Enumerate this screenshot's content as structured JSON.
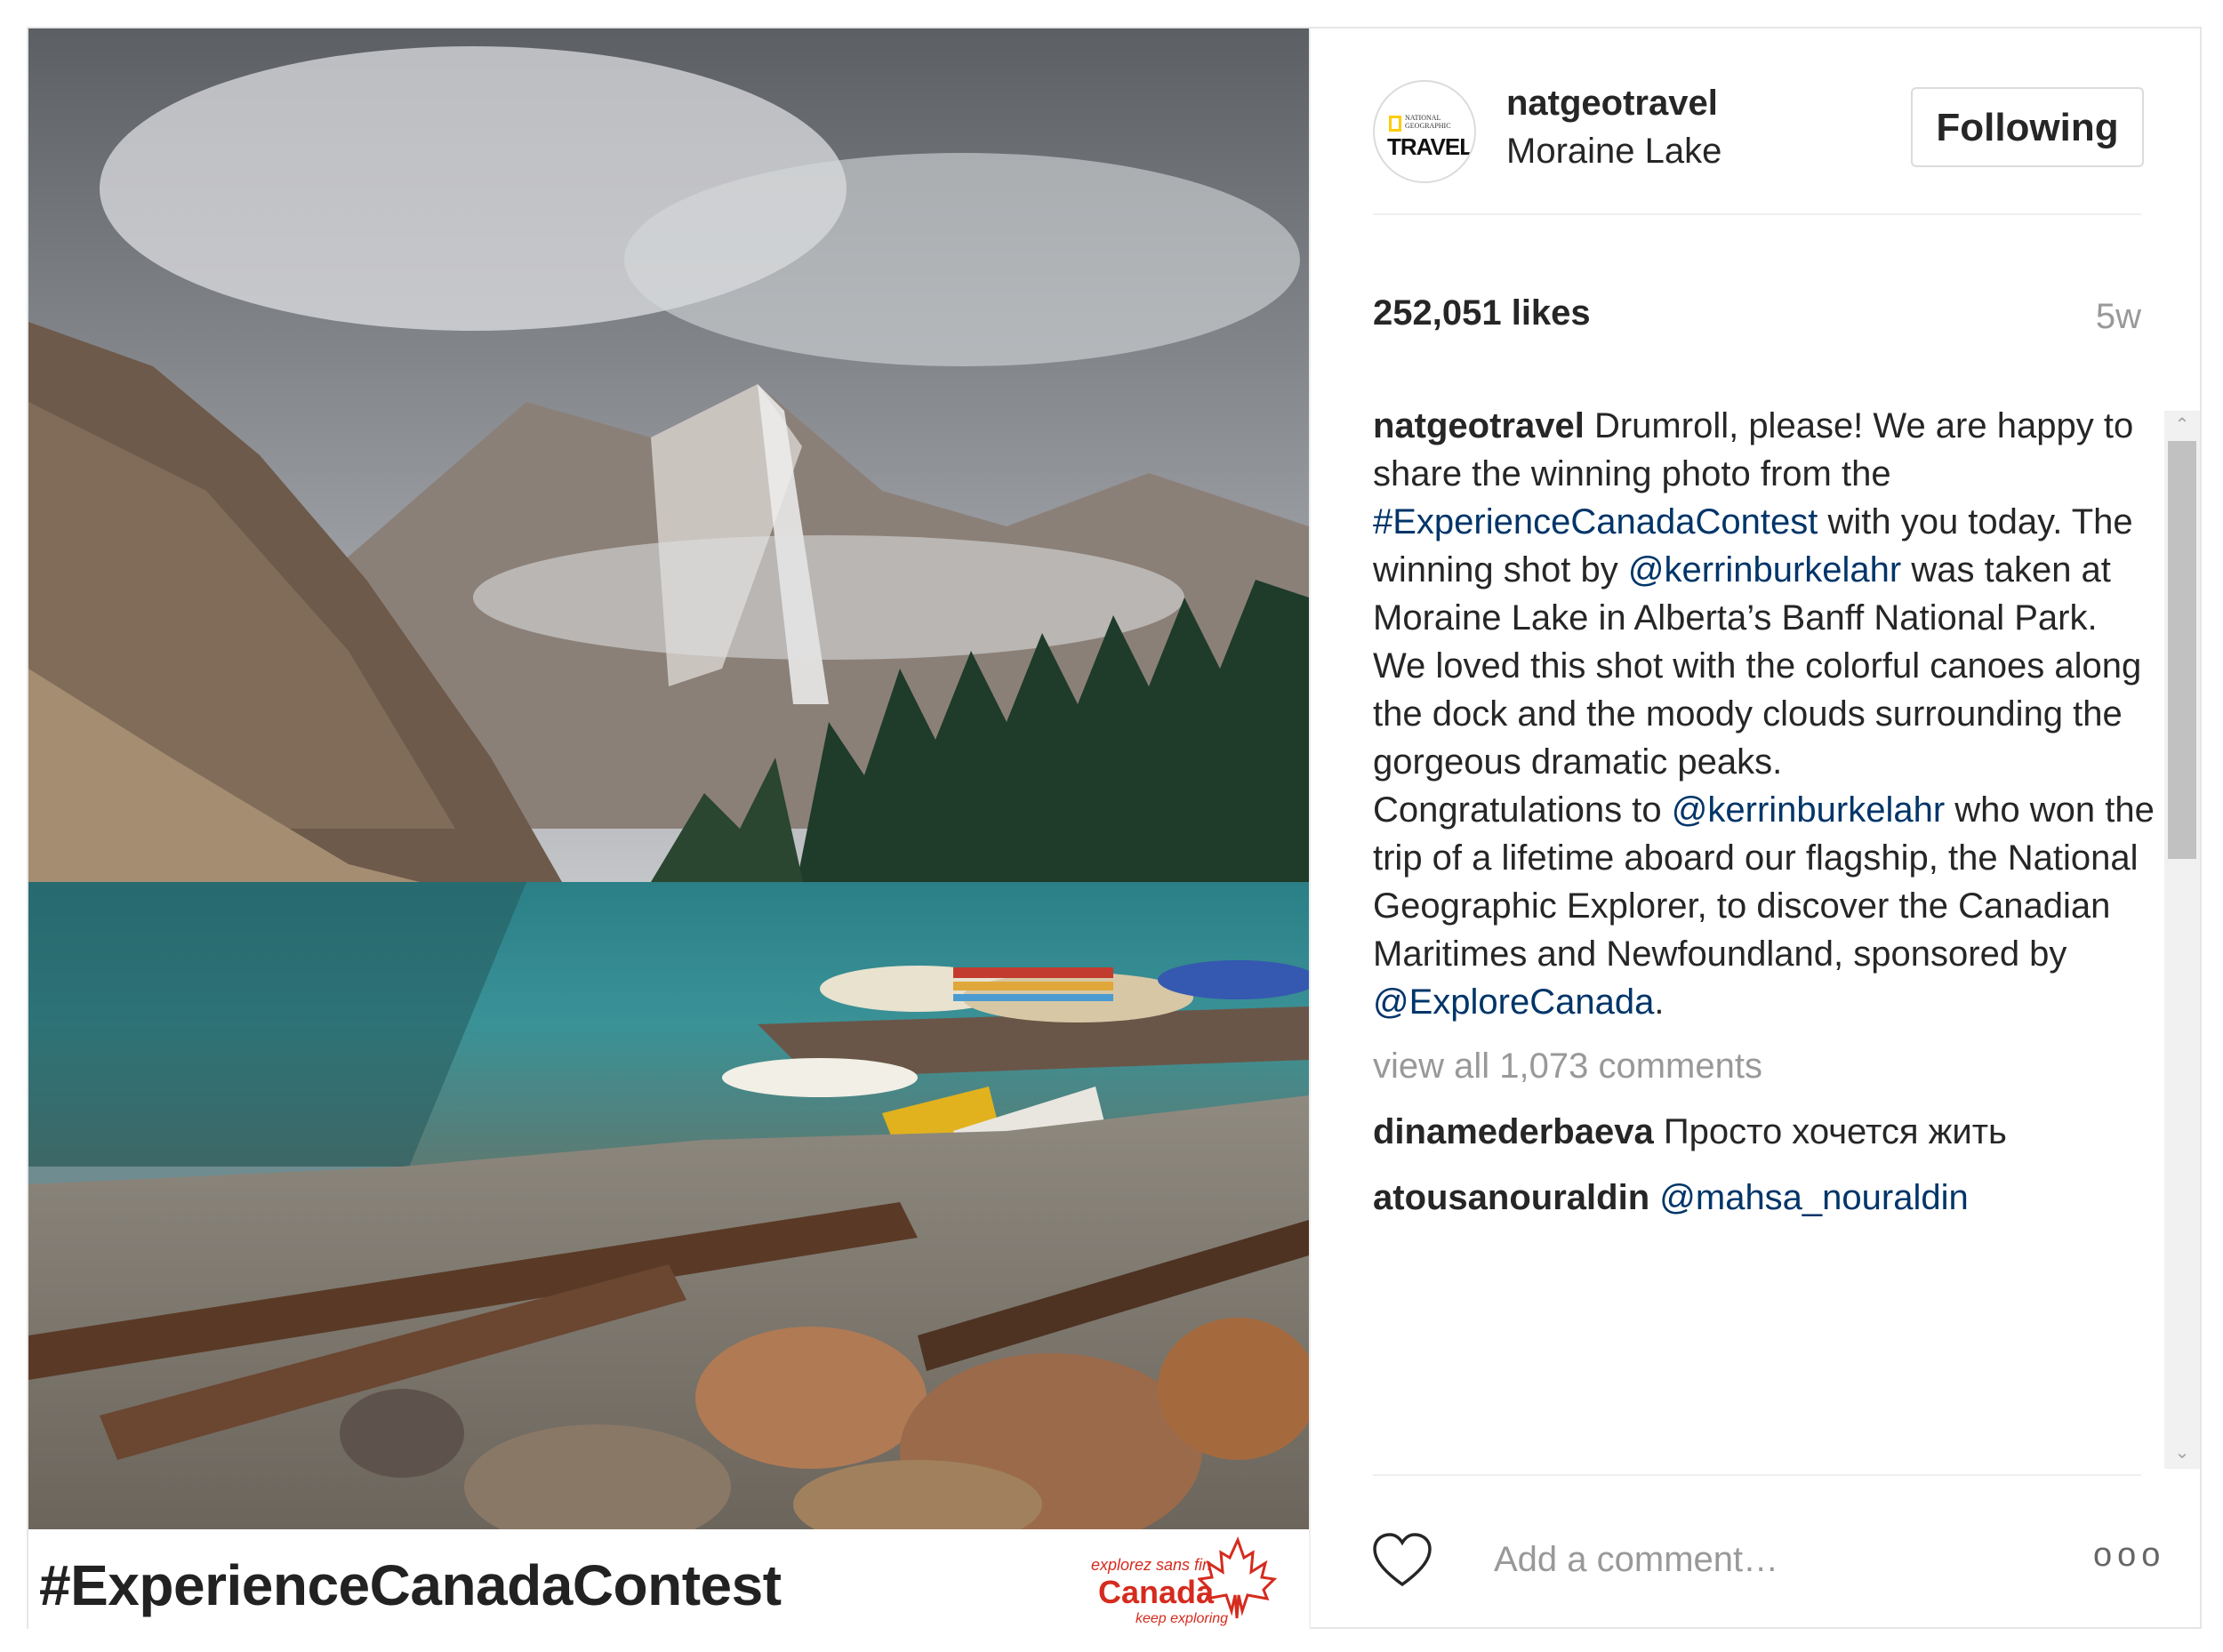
{
  "photo": {
    "banner_hashtag": "#ExperienceCanadaContest",
    "logo_line1": "explorez sans fin",
    "logo_line2": "Canada",
    "logo_line3": "keep exploring"
  },
  "header": {
    "avatar_small_text": "NATIONAL GEOGRAPHIC",
    "avatar_big_text": "TRAVEL",
    "username": "natgeotravel",
    "location": "Moraine Lake",
    "follow_label": "Following"
  },
  "stats": {
    "likes": "252,051 likes",
    "age": "5w"
  },
  "caption": {
    "username": "natgeotravel",
    "t1": " Drumroll, please! We are happy to share the winning photo from the ",
    "hashtag": "#ExperienceCanadaContest",
    "t2": " with you today. The winning shot by ",
    "mention1": "@kerrinburkelahr",
    "t3": " was taken at Moraine Lake in Alberta’s Banff National Park. We loved this shot with the colorful canoes along the dock and the moody clouds surrounding the gorgeous dramatic peaks.",
    "t4": "Congratulations to ",
    "mention2": "@kerrinburkelahr",
    "t5": " who won the trip of a lifetime aboard our flagship, the National Geographic Explorer, to discover the Canadian Maritimes and Newfoundland, sponsored by ",
    "mention3": "@ExploreCanada",
    "t6": "."
  },
  "comments": {
    "view_all": "view all 1,073 comments",
    "items": [
      {
        "user": "dinamederbaeva",
        "text": "Просто хочется жить"
      },
      {
        "user": "atousanouraldin",
        "text": "@mahsa_nouraldin"
      }
    ]
  },
  "footer": {
    "add_comment_placeholder": "Add a comment…",
    "more_label": "ooo"
  }
}
